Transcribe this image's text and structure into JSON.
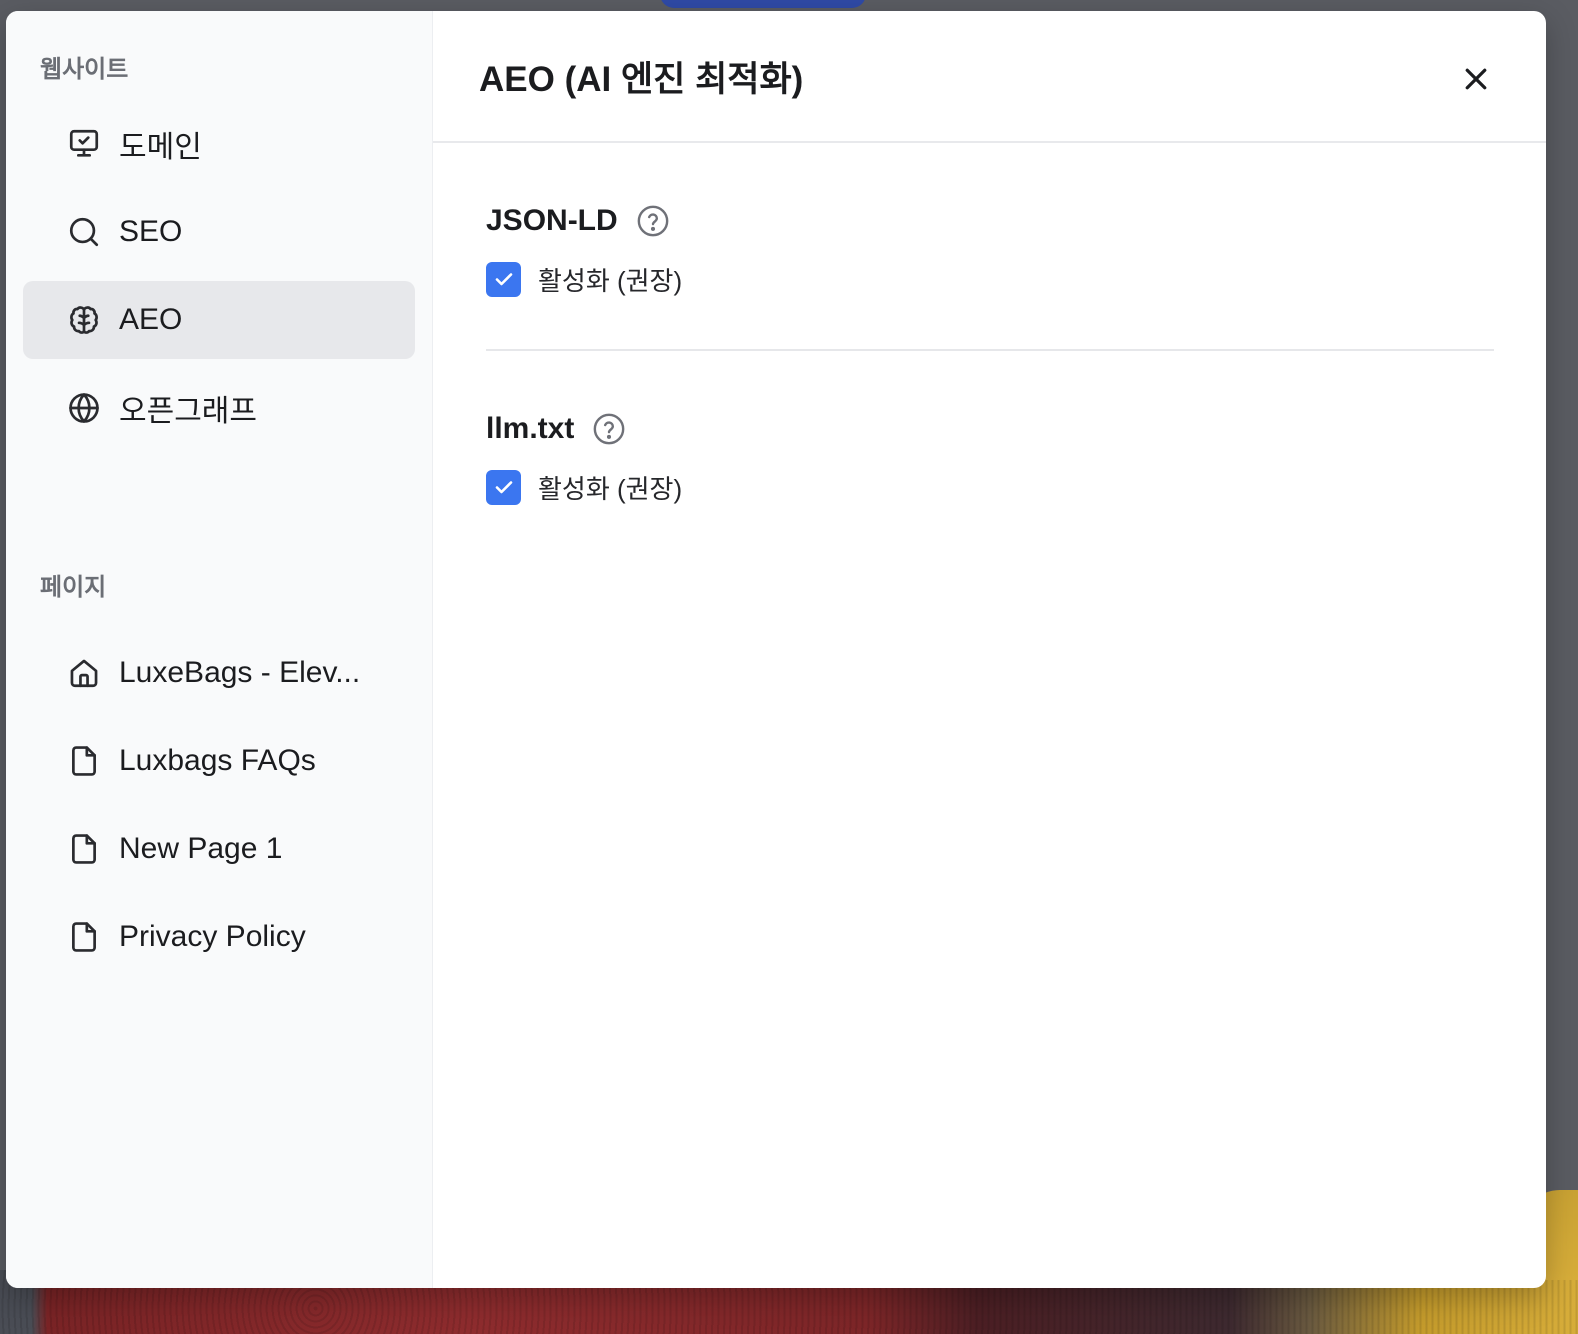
{
  "sidebar": {
    "website_label": "웹사이트",
    "website_items": [
      {
        "label": "도메인",
        "icon": "monitor-check-icon",
        "active": false
      },
      {
        "label": "SEO",
        "icon": "search-icon",
        "active": false
      },
      {
        "label": "AEO",
        "icon": "brain-icon",
        "active": true
      },
      {
        "label": "오픈그래프",
        "icon": "globe-icon",
        "active": false
      }
    ],
    "pages_label": "페이지",
    "page_items": [
      {
        "label": "LuxeBags - Elev...",
        "icon": "home-icon"
      },
      {
        "label": "Luxbags FAQs",
        "icon": "file-icon"
      },
      {
        "label": "New Page 1",
        "icon": "file-icon"
      },
      {
        "label": "Privacy Policy",
        "icon": "file-icon"
      }
    ]
  },
  "header": {
    "title": "AEO (AI 엔진 최적화)",
    "close_icon": "close-icon"
  },
  "settings": [
    {
      "title": "JSON-LD",
      "checkbox_label": "활성화 (권장)",
      "checked": true
    },
    {
      "title": "llm.txt",
      "checkbox_label": "활성화 (권장)",
      "checked": true
    }
  ],
  "colors": {
    "accent": "#3b76f0",
    "sidebar_bg": "#f9fafb",
    "active_item_bg": "#e7e8eb"
  }
}
